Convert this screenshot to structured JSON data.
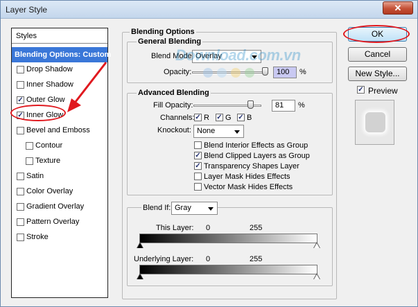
{
  "window": {
    "title": "Layer Style",
    "close_glyph": "✕"
  },
  "styles": {
    "header": "Styles",
    "selected_label": "Blending Options: Custom",
    "items": [
      {
        "label": "Drop Shadow",
        "checked": false
      },
      {
        "label": "Inner Shadow",
        "checked": false
      },
      {
        "label": "Outer Glow",
        "checked": true
      },
      {
        "label": "Inner Glow",
        "checked": true
      },
      {
        "label": "Bevel and Emboss",
        "checked": false
      },
      {
        "label": "Contour",
        "checked": false
      },
      {
        "label": "Texture",
        "checked": false
      },
      {
        "label": "Satin",
        "checked": false
      },
      {
        "label": "Color Overlay",
        "checked": false
      },
      {
        "label": "Gradient Overlay",
        "checked": false
      },
      {
        "label": "Pattern Overlay",
        "checked": false
      },
      {
        "label": "Stroke",
        "checked": false
      }
    ]
  },
  "blending_options": {
    "title": "Blending Options",
    "general": {
      "title": "General Blending",
      "blend_mode_label": "Blend Mode:",
      "blend_mode_value": "Overlay",
      "opacity_label": "Opacity:",
      "opacity_value": "100",
      "opacity_unit": "%"
    },
    "advanced": {
      "title": "Advanced Blending",
      "fill_opacity_label": "Fill Opacity:",
      "fill_opacity_value": "81",
      "fill_opacity_unit": "%",
      "channels_label": "Channels:",
      "channel_r": "R",
      "channel_g": "G",
      "channel_b": "B",
      "knockout_label": "Knockout:",
      "knockout_value": "None",
      "options": [
        {
          "label": "Blend Interior Effects as Group",
          "checked": false
        },
        {
          "label": "Blend Clipped Layers as Group",
          "checked": true
        },
        {
          "label": "Transparency Shapes Layer",
          "checked": true
        },
        {
          "label": "Layer Mask Hides Effects",
          "checked": false
        },
        {
          "label": "Vector Mask Hides Effects",
          "checked": false
        }
      ]
    },
    "blend_if": {
      "label": "Blend If:",
      "value": "Gray",
      "this_layer_label": "This Layer:",
      "this_layer_min": "0",
      "this_layer_max": "255",
      "underlying_label": "Underlying Layer:",
      "underlying_min": "0",
      "underlying_max": "255"
    }
  },
  "buttons": {
    "ok": "OK",
    "cancel": "Cancel",
    "new_style": "New Style...",
    "preview_label": "Preview"
  },
  "watermark": "Download.com.vn",
  "colors": {
    "selection": "#3a77d8",
    "annotation": "#e0191f"
  }
}
